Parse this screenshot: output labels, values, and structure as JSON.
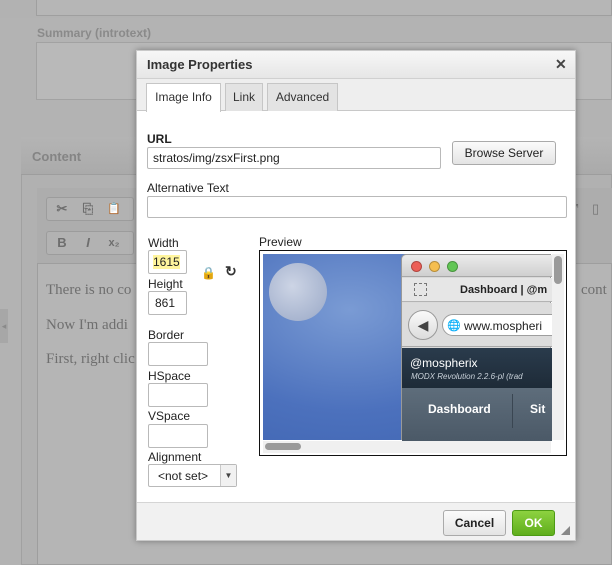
{
  "background": {
    "summary_label": "Summary (introtext)",
    "content_label": "Content",
    "paragraphs": [
      "There is no co",
      "Now I'm addi",
      "First, right clic"
    ],
    "right_text": "cont",
    "toolbar_glyphs": [
      "✂",
      "⎘",
      "📋",
      "B",
      "I",
      "x₂"
    ]
  },
  "dialog": {
    "title": "Image Properties",
    "close_glyph": "✕",
    "tabs": [
      {
        "label": "Image Info",
        "active": true
      },
      {
        "label": "Link",
        "active": false
      },
      {
        "label": "Advanced",
        "active": false
      }
    ],
    "url": {
      "label": "URL",
      "value": "stratos/img/zsxFirst.png"
    },
    "browse_label": "Browse Server",
    "alt_text": {
      "label": "Alternative Text",
      "value": ""
    },
    "width": {
      "label": "Width",
      "value": "1615"
    },
    "height": {
      "label": "Height",
      "value": "861"
    },
    "border": {
      "label": "Border",
      "value": ""
    },
    "hspace": {
      "label": "HSpace",
      "value": ""
    },
    "vspace": {
      "label": "VSpace",
      "value": ""
    },
    "alignment": {
      "label": "Alignment",
      "selected": "<not set>"
    },
    "lock_icon": "🔒",
    "reset_icon": "↻",
    "preview": {
      "label": "Preview",
      "tab_title": "Dashboard | @m",
      "url_text": "www.mospheri",
      "brand": "@mospherix",
      "version": "MODX Revolution 2.2.6-pl (trad",
      "nav_items": [
        "Dashboard",
        "Sit"
      ]
    },
    "cancel_label": "Cancel",
    "ok_label": "OK"
  },
  "colors": {
    "ok_green": "#6dbb26",
    "width_highlight": "#fff59d",
    "overlay_gray": "#b3b3b3"
  }
}
